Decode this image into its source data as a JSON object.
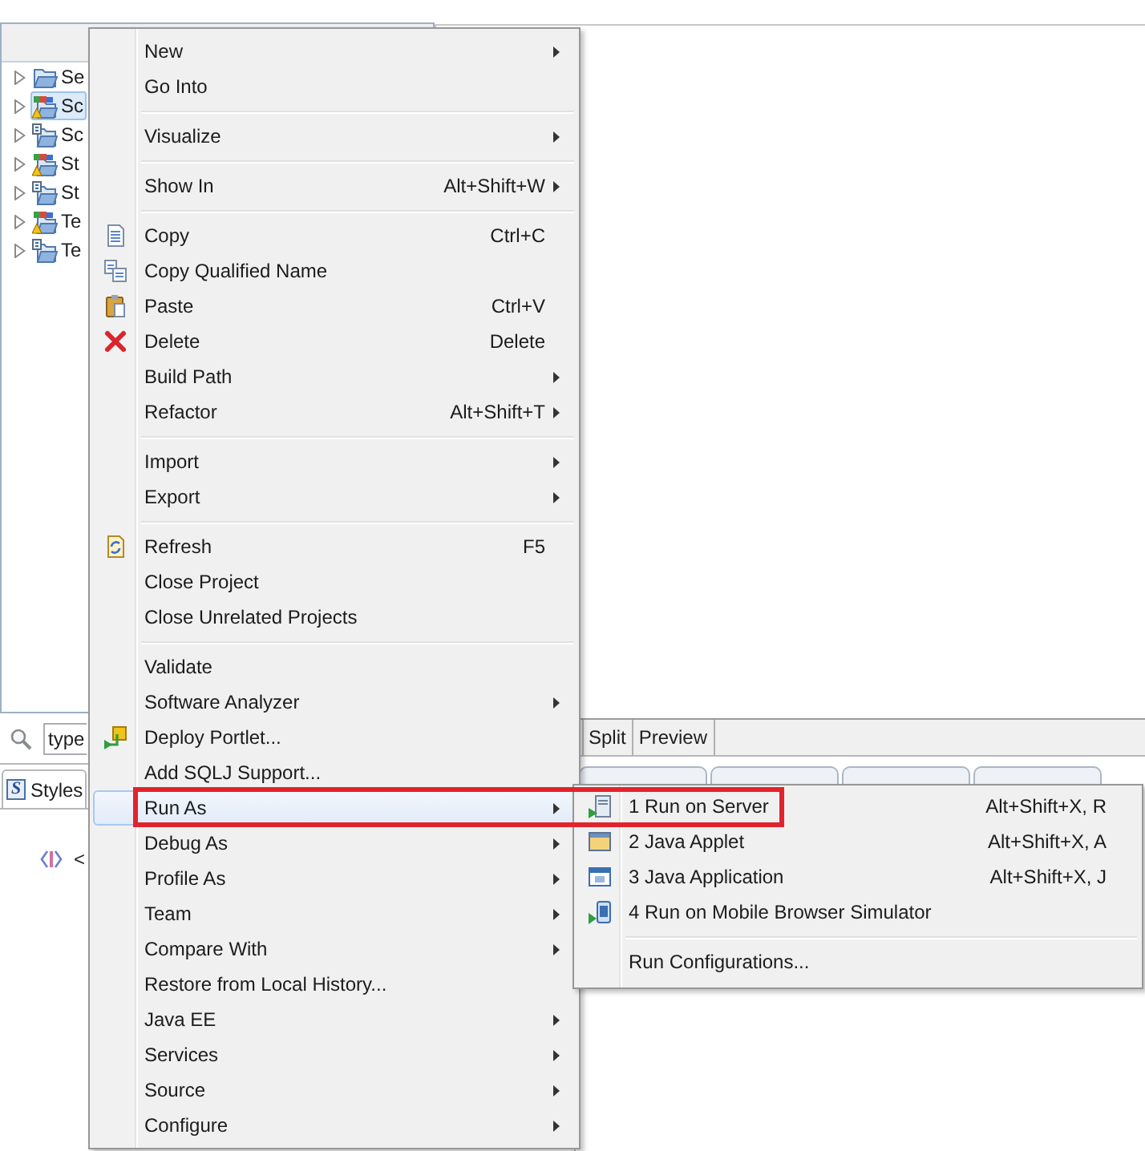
{
  "project_explorer": {
    "items": [
      {
        "label": "Se",
        "kind": "folder",
        "warning": false,
        "expanded": false,
        "selected": false
      },
      {
        "label": "Sc",
        "kind": "web-project",
        "warning": true,
        "expanded": false,
        "selected": true
      },
      {
        "label": "Sc",
        "kind": "project",
        "warning": false,
        "expanded": false,
        "selected": false
      },
      {
        "label": "St",
        "kind": "web-project",
        "warning": true,
        "expanded": false,
        "selected": false
      },
      {
        "label": "St",
        "kind": "project",
        "warning": false,
        "expanded": false,
        "selected": false
      },
      {
        "label": "Te",
        "kind": "web-project",
        "warning": true,
        "expanded": false,
        "selected": false
      },
      {
        "label": "Te",
        "kind": "project",
        "warning": false,
        "expanded": false,
        "selected": false
      }
    ]
  },
  "filter_field": {
    "value": "type"
  },
  "editor_tabs": [
    {
      "label": "Split",
      "selected": false
    },
    {
      "label": "Preview",
      "selected": false
    }
  ],
  "styles_view": {
    "tab": {
      "icon_letter": "S",
      "label": "Styles",
      "selected": true
    },
    "outline_node": "<"
  },
  "context_menu": {
    "groups": [
      [
        {
          "label": "New",
          "kind": "plain",
          "has_submenu": true,
          "selected": false
        },
        {
          "label": "Go Into",
          "kind": "plain",
          "has_submenu": false,
          "selected": false
        }
      ],
      [
        {
          "label": "Visualize",
          "kind": "plain",
          "has_submenu": true,
          "selected": false
        }
      ],
      [
        {
          "label": "Show In",
          "shortcut": "Alt+Shift+W",
          "kind": "plain",
          "has_submenu": true,
          "selected": false
        }
      ],
      [
        {
          "label": "Copy",
          "shortcut": "Ctrl+C",
          "kind": "copy",
          "has_submenu": false,
          "selected": false
        },
        {
          "label": "Copy Qualified Name",
          "kind": "copy-name",
          "has_submenu": false,
          "selected": false
        },
        {
          "label": "Paste",
          "shortcut": "Ctrl+V",
          "kind": "paste",
          "has_submenu": false,
          "selected": false
        },
        {
          "label": "Delete",
          "shortcut": "Delete",
          "kind": "delete",
          "has_submenu": false,
          "selected": false
        },
        {
          "label": "Build Path",
          "kind": "plain",
          "has_submenu": true,
          "selected": false
        },
        {
          "label": "Refactor",
          "shortcut": "Alt+Shift+T",
          "kind": "plain",
          "has_submenu": true,
          "selected": false
        }
      ],
      [
        {
          "label": "Import",
          "kind": "plain",
          "has_submenu": true,
          "selected": false
        },
        {
          "label": "Export",
          "kind": "plain",
          "has_submenu": true,
          "selected": false
        }
      ],
      [
        {
          "label": "Refresh",
          "shortcut": "F5",
          "kind": "refresh",
          "has_submenu": false,
          "selected": false
        },
        {
          "label": "Close Project",
          "kind": "plain",
          "has_submenu": false,
          "selected": false
        },
        {
          "label": "Close Unrelated Projects",
          "kind": "plain",
          "has_submenu": false,
          "selected": false
        }
      ],
      [
        {
          "label": "Validate",
          "kind": "plain",
          "has_submenu": false,
          "selected": false
        },
        {
          "label": "Software Analyzer",
          "kind": "plain",
          "has_submenu": true,
          "selected": false
        },
        {
          "label": "Deploy Portlet...",
          "kind": "deploy",
          "has_submenu": false,
          "selected": false
        },
        {
          "label": "Add SQLJ Support...",
          "kind": "plain",
          "has_submenu": false,
          "selected": false
        },
        {
          "label": "Run As",
          "kind": "plain",
          "has_submenu": true,
          "selected": true
        },
        {
          "label": "Debug As",
          "kind": "plain",
          "has_submenu": true,
          "selected": false
        },
        {
          "label": "Profile As",
          "kind": "plain",
          "has_submenu": true,
          "selected": false
        },
        {
          "label": "Team",
          "kind": "plain",
          "has_submenu": true,
          "selected": false
        },
        {
          "label": "Compare With",
          "kind": "plain",
          "has_submenu": true,
          "selected": false
        },
        {
          "label": "Restore from Local History...",
          "kind": "plain",
          "has_submenu": false,
          "selected": false
        },
        {
          "label": "Java EE",
          "kind": "plain",
          "has_submenu": true,
          "selected": false
        },
        {
          "label": "Services",
          "kind": "plain",
          "has_submenu": true,
          "selected": false
        },
        {
          "label": "Source",
          "kind": "plain",
          "has_submenu": true,
          "selected": false
        },
        {
          "label": "Configure",
          "kind": "plain",
          "has_submenu": true,
          "selected": false
        }
      ]
    ]
  },
  "run_as_submenu": {
    "groups": [
      [
        {
          "label": "1 Run on Server",
          "shortcut": "Alt+Shift+X, R",
          "kind": "server",
          "selected": false
        },
        {
          "label": "2 Java Applet",
          "shortcut": "Alt+Shift+X, A",
          "kind": "applet",
          "selected": false
        },
        {
          "label": "3 Java Application",
          "shortcut": "Alt+Shift+X, J",
          "kind": "application",
          "selected": false
        },
        {
          "label": "4 Run on Mobile Browser Simulator",
          "kind": "mobile",
          "selected": false
        }
      ],
      [
        {
          "label": "Run Configurations...",
          "kind": "plain",
          "selected": false
        }
      ]
    ]
  },
  "callout_box": true
}
